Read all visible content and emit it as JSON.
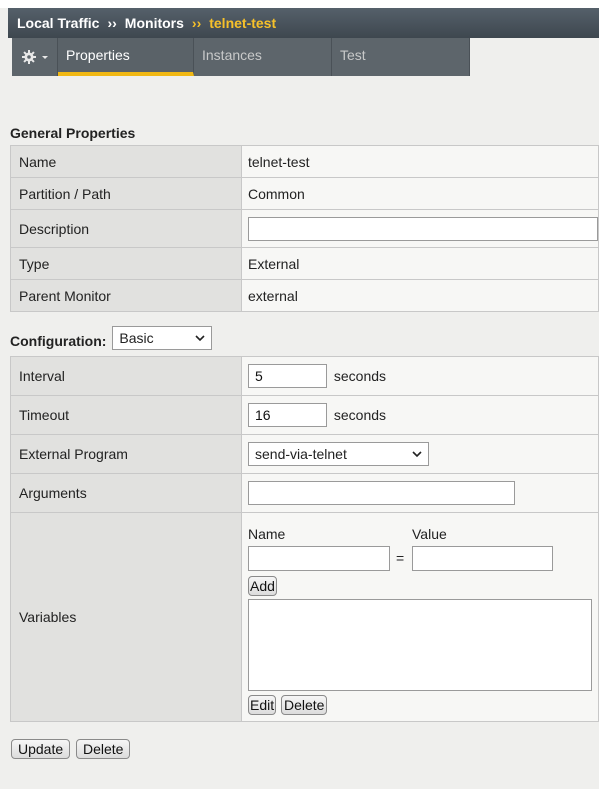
{
  "breadcrumb": {
    "part1": "Local Traffic",
    "sep": "››",
    "part2": "Monitors",
    "current": "telnet-test"
  },
  "tabs": [
    {
      "label": "Properties"
    },
    {
      "label": "Instances"
    },
    {
      "label": "Test"
    }
  ],
  "general": {
    "title": "General Properties",
    "rows": {
      "name": {
        "label": "Name",
        "value": "telnet-test"
      },
      "partition": {
        "label": "Partition / Path",
        "value": "Common"
      },
      "description": {
        "label": "Description",
        "value": ""
      },
      "type": {
        "label": "Type",
        "value": "External"
      },
      "parent": {
        "label": "Parent Monitor",
        "value": "external"
      }
    }
  },
  "config": {
    "title": "Configuration:",
    "mode": "Basic",
    "interval": {
      "label": "Interval",
      "value": "5",
      "unit": "seconds"
    },
    "timeout": {
      "label": "Timeout",
      "value": "16",
      "unit": "seconds"
    },
    "program": {
      "label": "External Program",
      "value": "send-via-telnet"
    },
    "arguments": {
      "label": "Arguments",
      "value": ""
    },
    "variables": {
      "label": "Variables",
      "name_header": "Name",
      "value_header": "Value",
      "equals": "=",
      "add": "Add",
      "edit": "Edit",
      "delete": "Delete"
    }
  },
  "actions": {
    "update": "Update",
    "delete": "Delete"
  }
}
